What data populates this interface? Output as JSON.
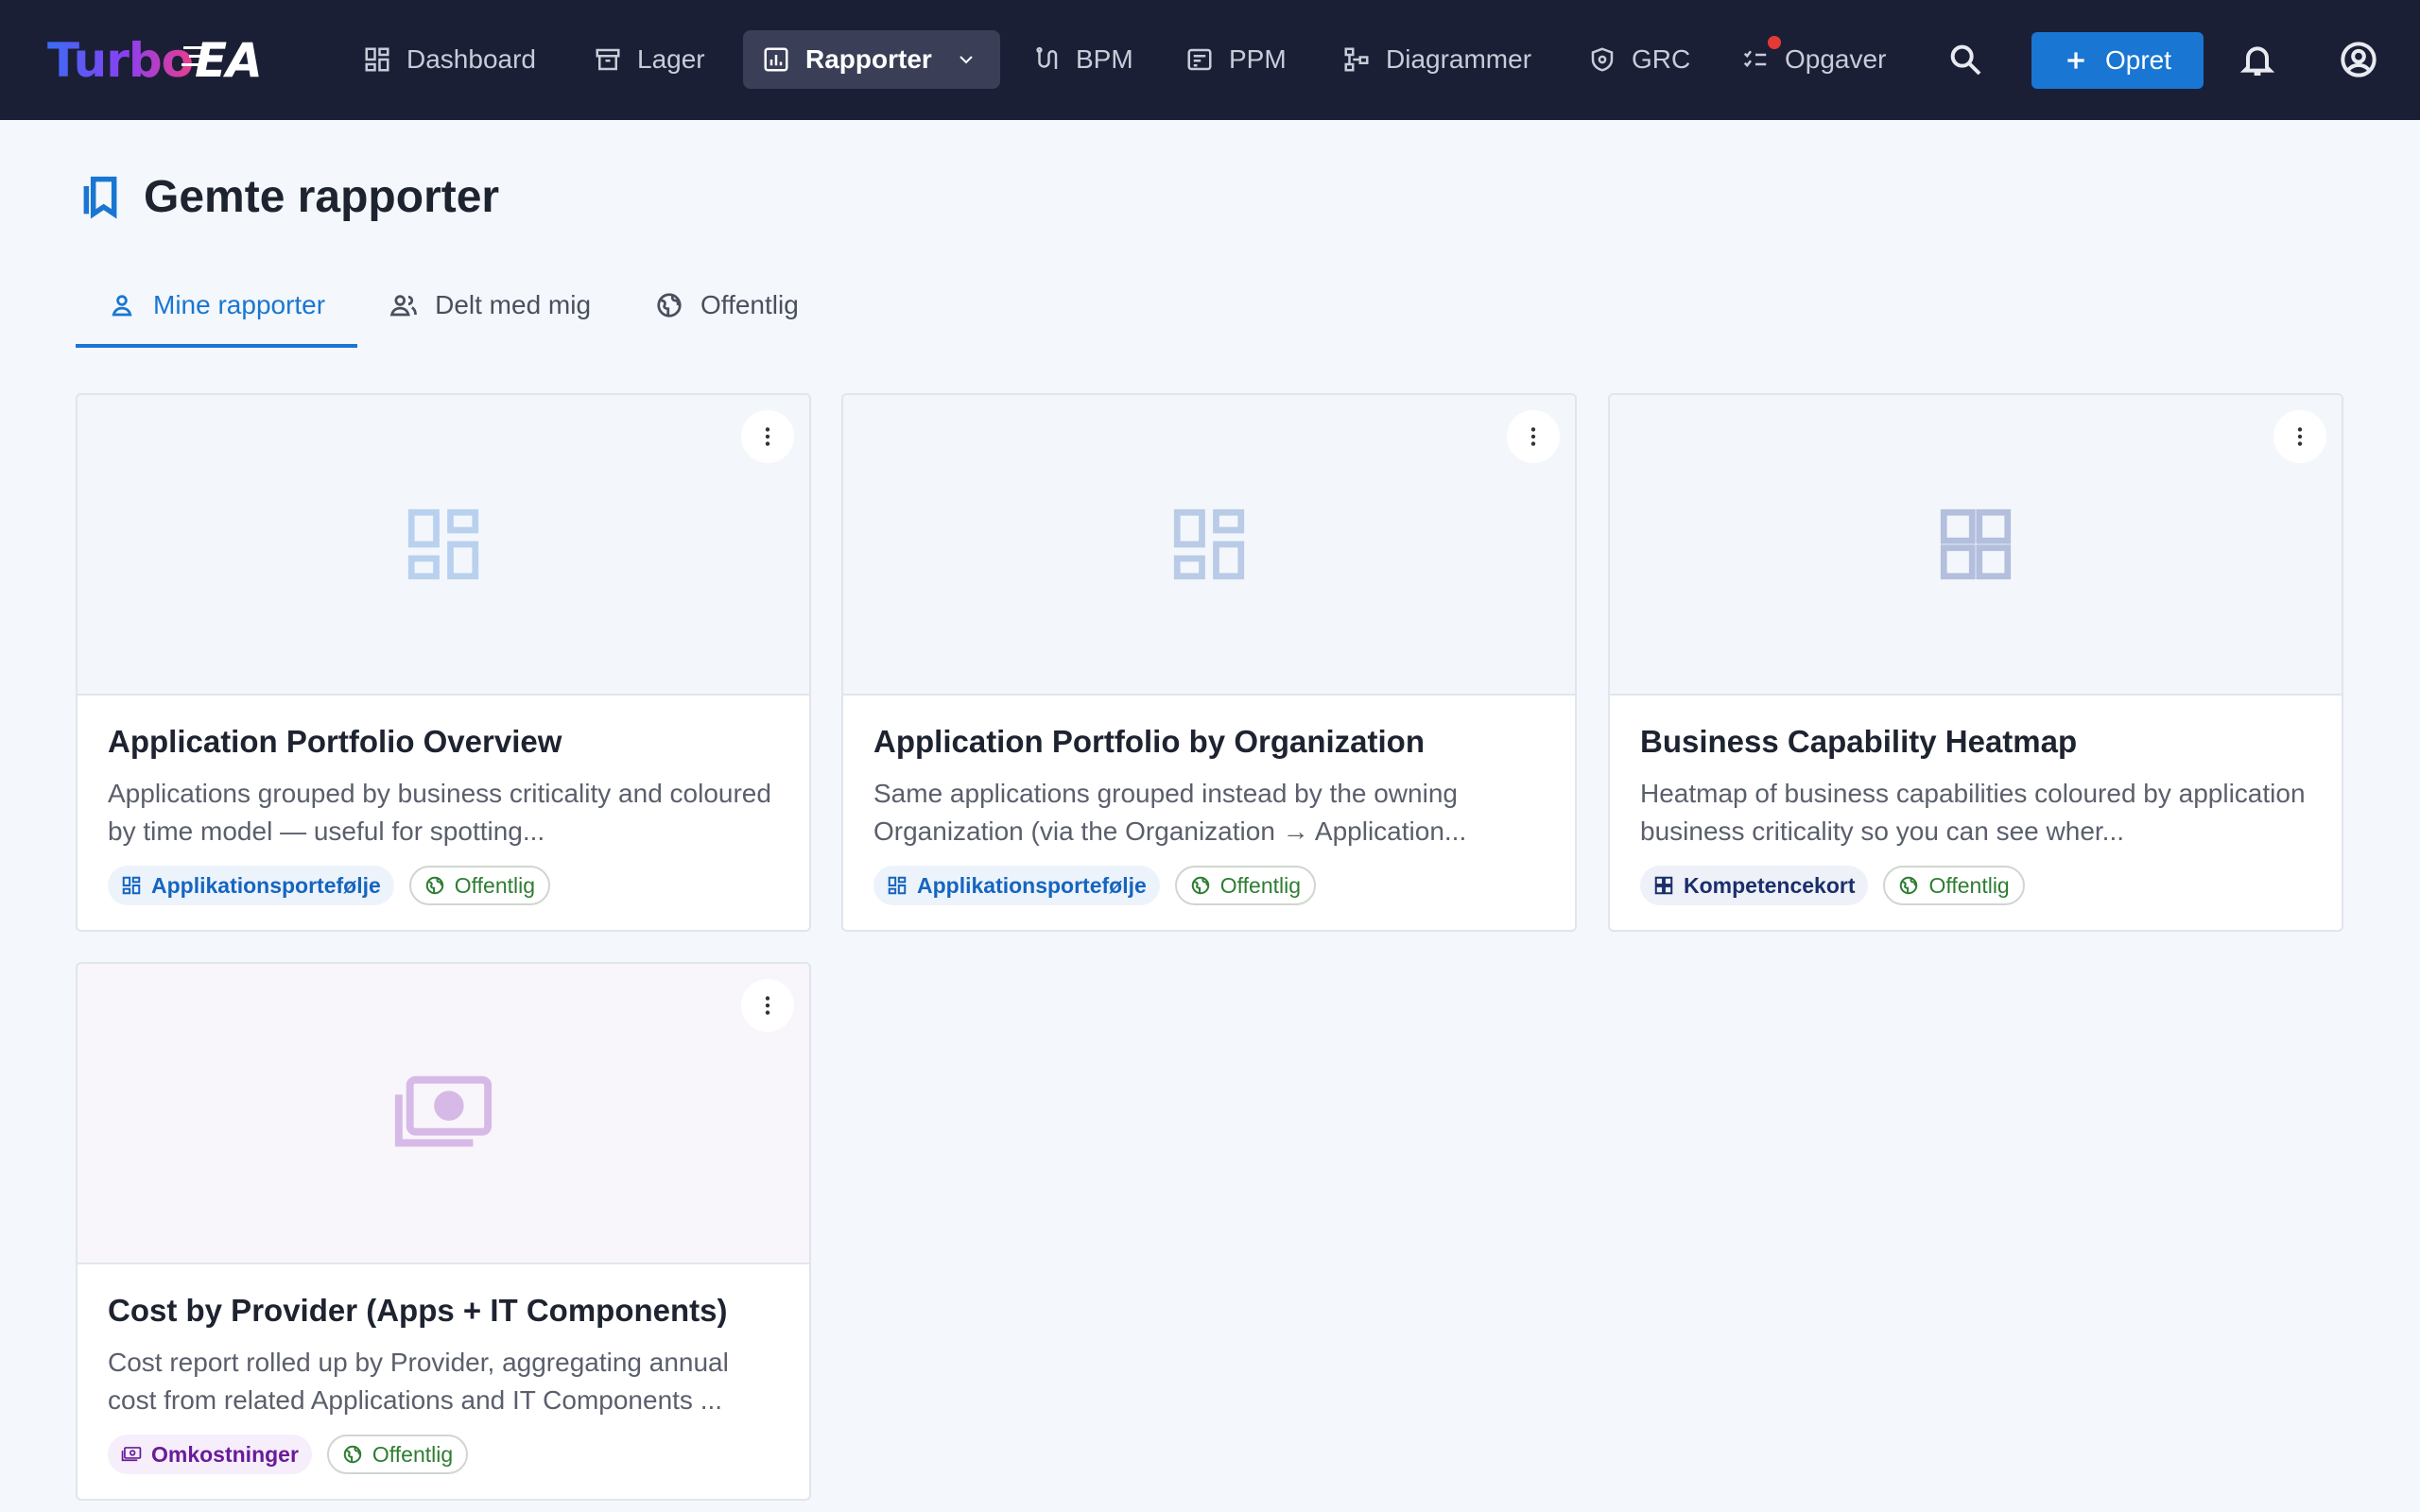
{
  "app": {
    "logo_main": "Turbo",
    "logo_accent": "EA"
  },
  "nav": {
    "items": [
      {
        "label": "Dashboard",
        "icon": "dashboard-icon"
      },
      {
        "label": "Lager",
        "icon": "archive-icon"
      },
      {
        "label": "Rapporter",
        "icon": "report-icon",
        "active": true
      },
      {
        "label": "BPM",
        "icon": "flow-icon"
      },
      {
        "label": "PPM",
        "icon": "project-icon"
      },
      {
        "label": "Diagrammer",
        "icon": "diagram-icon"
      },
      {
        "label": "GRC",
        "icon": "shield-icon"
      },
      {
        "label": "Opgaver",
        "icon": "tasks-icon",
        "has_notification": true
      }
    ],
    "create_label": "Opret"
  },
  "colors": {
    "nav_bg": "#1b1f36",
    "accent": "#1976d2",
    "public_green": "#2e7d32",
    "notification": "#e53935"
  },
  "page": {
    "title": "Gemte rapporter",
    "icon": "bookmarks-icon"
  },
  "tabs": [
    {
      "label": "Mine rapporter",
      "icon": "person-icon",
      "active": true
    },
    {
      "label": "Delt med mig",
      "icon": "people-icon"
    },
    {
      "label": "Offentlig",
      "icon": "globe-icon"
    }
  ],
  "reports": [
    {
      "title": "Application Portfolio Overview",
      "description": "Applications grouped by business criticality and coloured by time model — useful for spotting...",
      "type_label": "Applikationsportefølje",
      "visibility_label": "Offentlig",
      "thumb_icon": "grid-icon"
    },
    {
      "title": "Application Portfolio by Organization",
      "description": "Same applications grouped instead by the owning Organization (via the Organization → Application...",
      "type_label": "Applikationsportefølje",
      "visibility_label": "Offentlig",
      "thumb_icon": "grid-icon"
    },
    {
      "title": "Business Capability Heatmap",
      "description": "Heatmap of business capabilities coloured by application business criticality so you can see wher...",
      "type_label": "Kompetencekort",
      "visibility_label": "Offentlig",
      "thumb_icon": "grid-icon"
    },
    {
      "title": "Cost by Provider (Apps + IT Components)",
      "description": "Cost report rolled up by Provider, aggregating annual cost from related Applications and IT Components ...",
      "type_label": "Omkostninger",
      "visibility_label": "Offentlig",
      "thumb_icon": "money-icon"
    }
  ]
}
